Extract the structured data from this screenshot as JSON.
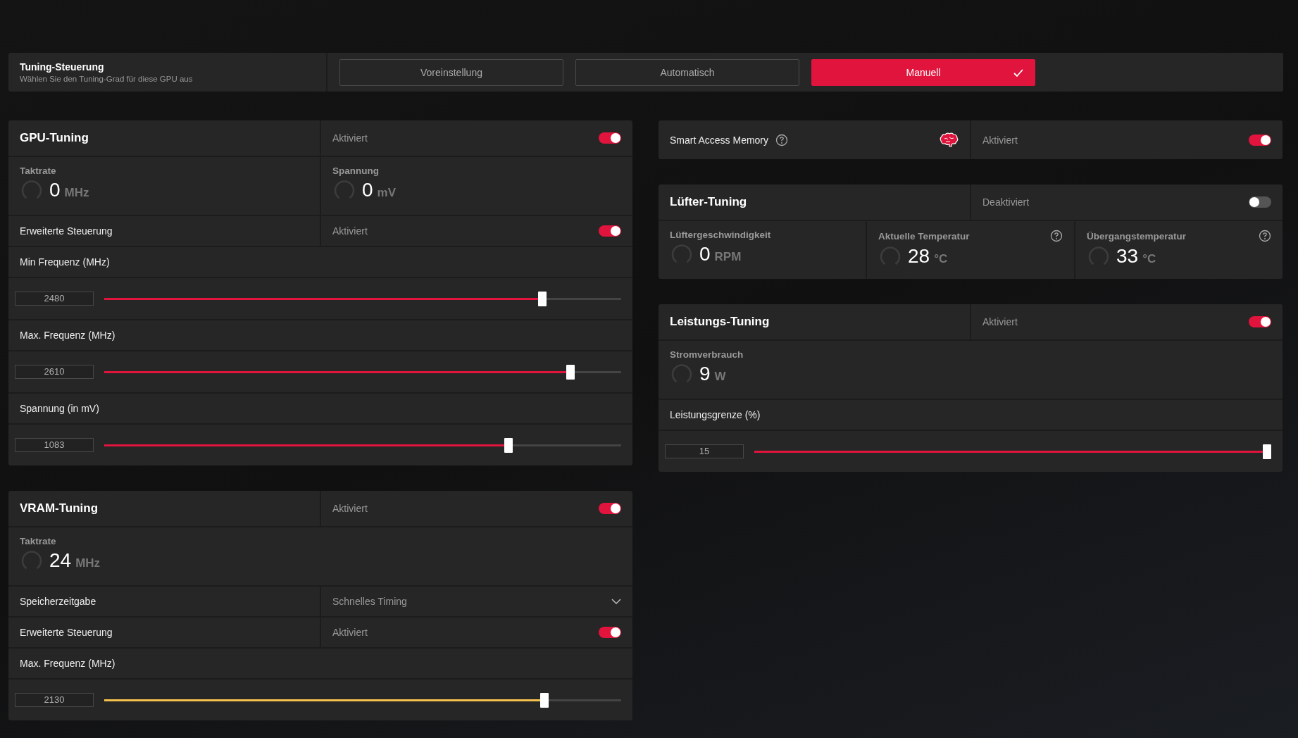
{
  "tuning_control": {
    "title": "Tuning-Steuerung",
    "subtitle": "Wählen Sie den Tuning-Grad für diese GPU aus",
    "options": [
      {
        "label": "Voreinstellung",
        "selected": false
      },
      {
        "label": "Automatisch",
        "selected": false
      },
      {
        "label": "Manuell",
        "selected": true
      }
    ]
  },
  "left_panels": [
    {
      "kind": "section",
      "title": "GPU-Tuning",
      "status": "Aktiviert",
      "on": true,
      "rows": [
        {
          "kind": "gauges",
          "items": [
            {
              "label": "Taktrate",
              "value": "0",
              "unit": "MHz",
              "help": false
            },
            {
              "label": "Spannung",
              "value": "0",
              "unit": "mV",
              "help": false
            }
          ]
        },
        {
          "kind": "toggle",
          "label": "Erweiterte Steuerung",
          "status": "Aktiviert",
          "on": true
        },
        {
          "kind": "label",
          "label": "Min Frequenz (MHz)"
        },
        {
          "kind": "slider",
          "value": "2480",
          "level": 0.855,
          "color": "#e0143c"
        },
        {
          "kind": "label",
          "label": "Max. Frequenz (MHz)"
        },
        {
          "kind": "slider",
          "value": "2610",
          "level": 0.91,
          "color": "#e0143c"
        },
        {
          "kind": "label",
          "label": "Spannung (in mV)"
        },
        {
          "kind": "slider",
          "value": "1083",
          "level": 0.79,
          "color": "#e0143c"
        }
      ]
    },
    {
      "kind": "section",
      "title": "VRAM-Tuning",
      "status": "Aktiviert",
      "on": true,
      "rows": [
        {
          "kind": "gauges",
          "items": [
            {
              "label": "Taktrate",
              "value": "24",
              "unit": "MHz",
              "help": false
            }
          ]
        },
        {
          "kind": "dropdown",
          "label": "Speicherzeitgabe",
          "value": "Schnelles Timing"
        },
        {
          "kind": "toggle",
          "label": "Erweiterte Steuerung",
          "status": "Aktiviert",
          "on": true
        },
        {
          "kind": "label",
          "label": "Max. Frequenz (MHz)"
        },
        {
          "kind": "slider",
          "value": "2130",
          "level": 0.86,
          "color": "#f2c14e"
        }
      ]
    }
  ],
  "right_panels": [
    {
      "kind": "feature",
      "title": "Smart Access Memory",
      "status": "Aktiviert",
      "on": true
    },
    {
      "kind": "section",
      "title": "Lüfter-Tuning",
      "status": "Deaktiviert",
      "on": false,
      "rows": [
        {
          "kind": "gauges",
          "items": [
            {
              "label": "Lüftergeschwindigkeit",
              "value": "0",
              "unit": "RPM",
              "help": false
            },
            {
              "label": "Aktuelle Temperatur",
              "value": "28",
              "unit": "°C",
              "help": true
            },
            {
              "label": "Übergangstemperatur",
              "value": "33",
              "unit": "°C",
              "help": true
            }
          ]
        }
      ]
    },
    {
      "kind": "section",
      "title": "Leistungs-Tuning",
      "status": "Aktiviert",
      "on": true,
      "rows": [
        {
          "kind": "gauges",
          "items": [
            {
              "label": "Stromverbrauch",
              "value": "9",
              "unit": "W",
              "help": false
            }
          ]
        },
        {
          "kind": "label",
          "label": "Leistungsgrenze (%)"
        },
        {
          "kind": "slider",
          "value": "15",
          "level": 1,
          "color": "#e0143c"
        }
      ]
    }
  ]
}
